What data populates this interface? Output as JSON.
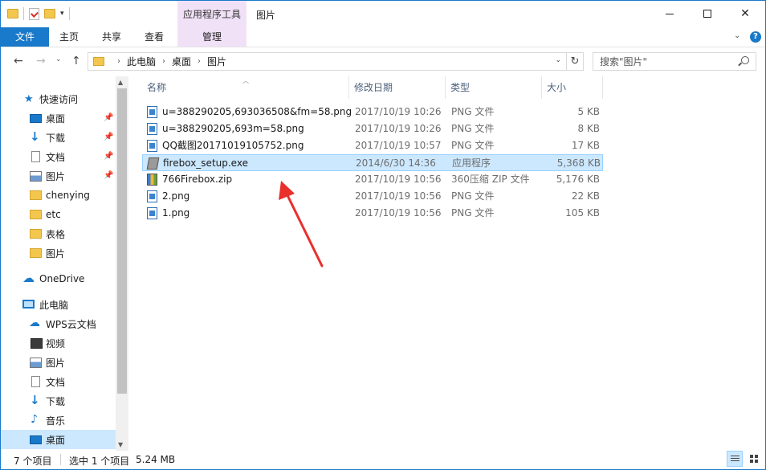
{
  "titlebar": {
    "context_tab": "应用程序工具",
    "title": "图片"
  },
  "ribbon": {
    "tabs": [
      "文件",
      "主页",
      "共享",
      "查看",
      "管理"
    ]
  },
  "address": {
    "crumbs": [
      "此电脑",
      "桌面",
      "图片"
    ]
  },
  "search": {
    "placeholder": "搜索\"图片\""
  },
  "sidebar": {
    "items": [
      {
        "label": "快速访问",
        "icon": "star-icon"
      },
      {
        "label": "桌面",
        "icon": "desktop-icon",
        "pinned": true
      },
      {
        "label": "下载",
        "icon": "download-icon",
        "pinned": true
      },
      {
        "label": "文档",
        "icon": "document-icon",
        "pinned": true
      },
      {
        "label": "图片",
        "icon": "pictures-icon",
        "pinned": true
      },
      {
        "label": "chenying",
        "icon": "folder-icon"
      },
      {
        "label": "etc",
        "icon": "folder-icon"
      },
      {
        "label": "表格",
        "icon": "folder-icon"
      },
      {
        "label": "图片",
        "icon": "folder-icon"
      },
      {
        "label": "OneDrive",
        "icon": "cloud-icon"
      },
      {
        "label": "此电脑",
        "icon": "computer-icon"
      },
      {
        "label": "WPS云文档",
        "icon": "wps-cloud-icon"
      },
      {
        "label": "视频",
        "icon": "video-icon"
      },
      {
        "label": "图片",
        "icon": "pictures-icon"
      },
      {
        "label": "文档",
        "icon": "document-icon"
      },
      {
        "label": "下载",
        "icon": "download-icon"
      },
      {
        "label": "音乐",
        "icon": "music-icon"
      },
      {
        "label": "桌面",
        "icon": "desktop-icon",
        "selected": true
      }
    ]
  },
  "columns": [
    "名称",
    "修改日期",
    "类型",
    "大小"
  ],
  "files": [
    {
      "name": "u=388290205,693036508&fm=58.png",
      "date": "2017/10/19 10:26",
      "type": "PNG 文件",
      "size": "5 KB",
      "icon": "png-file-icon"
    },
    {
      "name": "u=388290205,693m=58.png",
      "date": "2017/10/19 10:26",
      "type": "PNG 文件",
      "size": "8 KB",
      "icon": "png-file-icon"
    },
    {
      "name": "QQ截图20171019105752.png",
      "date": "2017/10/19 10:57",
      "type": "PNG 文件",
      "size": "17 KB",
      "icon": "png-file-icon"
    },
    {
      "name": "firebox_setup.exe",
      "date": "2014/6/30 14:36",
      "type": "应用程序",
      "size": "5,368 KB",
      "icon": "exe-file-icon",
      "selected": true
    },
    {
      "name": "766Firebox.zip",
      "date": "2017/10/19 10:56",
      "type": "360压缩 ZIP 文件",
      "size": "5,176 KB",
      "icon": "zip-file-icon"
    },
    {
      "name": "2.png",
      "date": "2017/10/19 10:56",
      "type": "PNG 文件",
      "size": "22 KB",
      "icon": "png-file-icon"
    },
    {
      "name": "1.png",
      "date": "2017/10/19 10:56",
      "type": "PNG 文件",
      "size": "105 KB",
      "icon": "png-file-icon"
    }
  ],
  "status": {
    "count": "7 个项目",
    "selected": "选中 1 个项目",
    "size": "5.24 MB"
  },
  "colors": {
    "accent": "#1979ca",
    "selection": "#cce8ff",
    "context_tab": "#f1e1f7",
    "annotation_arrow": "#e8302c"
  }
}
